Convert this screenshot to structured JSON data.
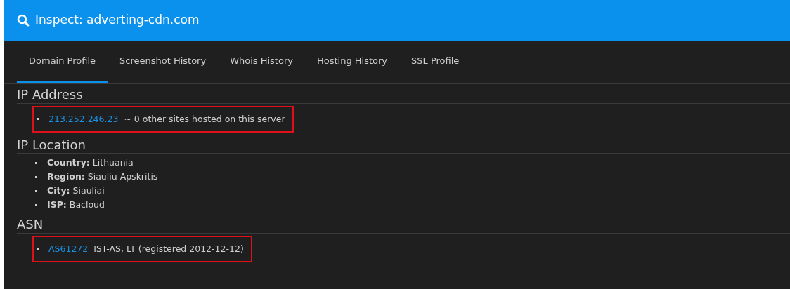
{
  "header": {
    "title": "Inspect: adverting-cdn.com"
  },
  "tabs": [
    {
      "label": "Domain Profile",
      "selected": true
    },
    {
      "label": "Screenshot History",
      "selected": false
    },
    {
      "label": "Whois History",
      "selected": false
    },
    {
      "label": "Hosting History",
      "selected": false
    },
    {
      "label": "SSL Profile",
      "selected": false
    }
  ],
  "sections": [
    {
      "heading": "IP Address",
      "items": [
        {
          "kind": "link",
          "link": "213.252.246.23",
          "text": "~ 0 other sites hosted on this server",
          "highlighted": true
        }
      ]
    },
    {
      "heading": "IP Location",
      "items": [
        {
          "kind": "field",
          "text": "**Country:** Lithuania",
          "highlighted": false
        },
        {
          "kind": "field",
          "text": "**Region:** Siauliu Apskritis",
          "highlighted": false
        },
        {
          "kind": "field",
          "text": "**City:** Siauliai",
          "highlighted": false
        },
        {
          "kind": "field",
          "text": "**ISP:** Bacloud",
          "highlighted": false
        }
      ]
    },
    {
      "heading": "ASN",
      "items": [
        {
          "kind": "link",
          "link": "AS61272",
          "text": "IST-AS, LT (registered 2012-12-12)",
          "highlighted": true
        }
      ]
    }
  ]
}
